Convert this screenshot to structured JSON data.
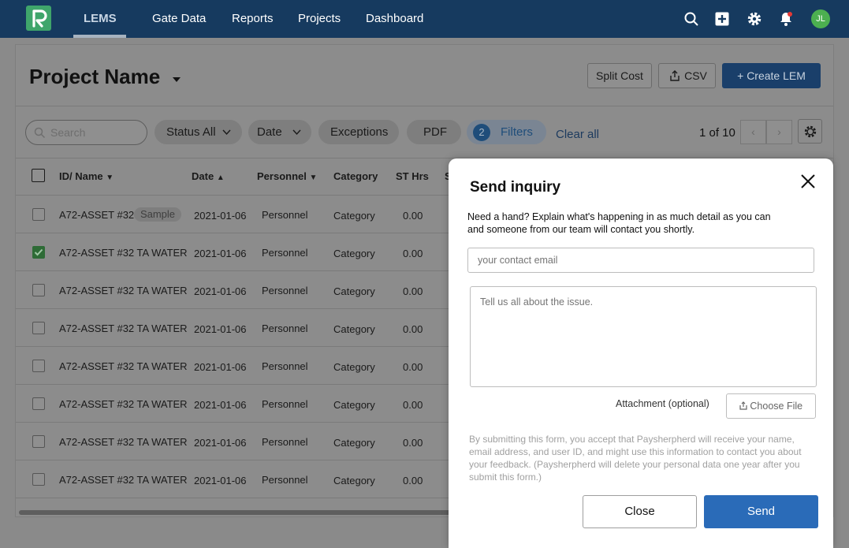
{
  "nav": {
    "items": [
      "LEMS",
      "Gate Data",
      "Reports",
      "Projects",
      "Dashboard"
    ],
    "active": "LEMS",
    "avatar_initials": "JL",
    "icons": [
      "search-icon",
      "add-icon",
      "gear-icon",
      "bell-icon"
    ],
    "background": "#163a5f"
  },
  "header": {
    "project_title": "Project Name",
    "split_cost_label": "Split Cost",
    "csv_label": "CSV",
    "create_lem_label": "Create LEM"
  },
  "filters": {
    "search_placeholder": "Search",
    "status_label": "Status All",
    "date_label": "Date",
    "exceptions_label": "Exceptions",
    "pdf_label": "PDF",
    "filters_count": "2",
    "filters_label": "Filters",
    "clear_all_label": "Clear all",
    "pager_text": "1 of 10"
  },
  "table": {
    "columns": [
      "ID/ Name",
      "Date",
      "Personnel",
      "Category",
      "ST Hrs",
      "S"
    ],
    "sample_badge": "Sample",
    "rows": [
      {
        "name": "A72-ASSET #32 T.",
        "date": "2021-01-06",
        "personnel": "Personnel",
        "category": "Category",
        "st_hrs": "0.00",
        "checked": false
      },
      {
        "name": "A72-ASSET #32 TA WATER",
        "date": "2021-01-06",
        "personnel": "Personnel",
        "category": "Category",
        "st_hrs": "0.00",
        "checked": true
      },
      {
        "name": "A72-ASSET #32 TA WATER",
        "date": "2021-01-06",
        "personnel": "Personnel",
        "category": "Category",
        "st_hrs": "0.00",
        "checked": false
      },
      {
        "name": "A72-ASSET #32 TA WATER",
        "date": "2021-01-06",
        "personnel": "Personnel",
        "category": "Category",
        "st_hrs": "0.00",
        "checked": false
      },
      {
        "name": "A72-ASSET #32 TA WATER",
        "date": "2021-01-06",
        "personnel": "Personnel",
        "category": "Category",
        "st_hrs": "0.00",
        "checked": false
      },
      {
        "name": "A72-ASSET #32 TA WATER",
        "date": "2021-01-06",
        "personnel": "Personnel",
        "category": "Category",
        "st_hrs": "0.00",
        "checked": false
      },
      {
        "name": "A72-ASSET #32 TA WATER",
        "date": "2021-01-06",
        "personnel": "Personnel",
        "category": "Category",
        "st_hrs": "0.00",
        "checked": false
      },
      {
        "name": "A72-ASSET #32 TA WATER",
        "date": "2021-01-06",
        "personnel": "Personnel",
        "category": "Category",
        "st_hrs": "0.00",
        "checked": false
      }
    ]
  },
  "modal": {
    "title": "Send inquiry",
    "description": "Need a hand? Explain what's happening in as much detail as you can and someone from our team will contact you shortly.",
    "email_placeholder": "your contact email",
    "issue_placeholder": "Tell us all about the issue.",
    "attachment_label": "Attachment (optional)",
    "choose_file_label": "Choose File",
    "legal_text": "By submitting this form, you accept that Paysherpherd will receive your name, email address, and user ID, and might use this information to contact you about your feedback. (Paysherpherd will delete your personal data one year after you submit this form.)",
    "close_label": "Close",
    "send_label": "Send",
    "send_color": "#2a6bb8"
  }
}
